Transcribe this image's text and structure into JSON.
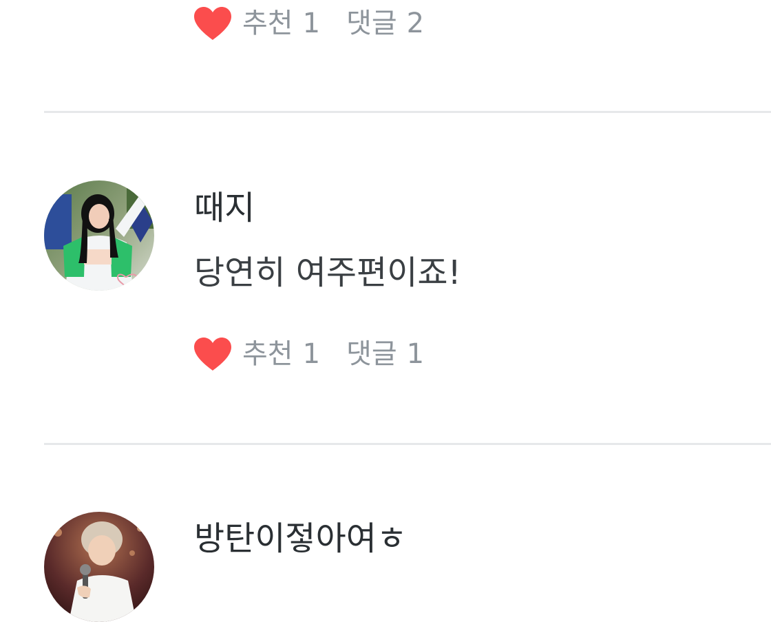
{
  "comments": [
    {
      "recommend_label": "추천",
      "recommend_count": "1",
      "reply_label": "댓글",
      "reply_count": "2"
    },
    {
      "author": "때지",
      "text": "당연히 여주편이죠!",
      "recommend_label": "추천",
      "recommend_count": "1",
      "reply_label": "댓글",
      "reply_count": "1"
    },
    {
      "author": "방탄이젛아여ㅎ"
    }
  ],
  "icons": {
    "heart": "heart-icon"
  },
  "colors": {
    "heart": "#fb4d4d",
    "meta_text": "#8d949b",
    "divider": "#e6e8ea",
    "author_text": "#2a2f33"
  }
}
